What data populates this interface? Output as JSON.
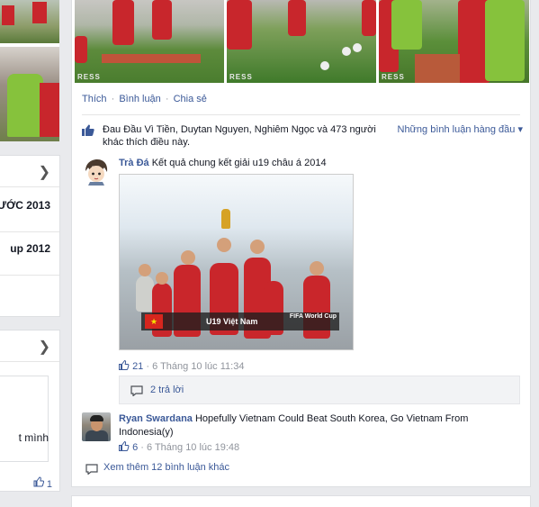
{
  "left": {
    "card1": {
      "items": [
        "ƯỚC 2013",
        "up 2012"
      ]
    },
    "card2": {
      "text": "t mình",
      "like_count": "1"
    }
  },
  "photos": {
    "watermark": "RESS"
  },
  "post_actions": {
    "like": "Thích",
    "comment": "Bình luận",
    "share": "Chia sẻ",
    "separator": "·"
  },
  "likes": {
    "text": "Đau Đầu Vì Tiền, Duytan Nguyen, Nghiêm Ngọc và 473 người khác thích điều này.",
    "sort_label": "Những bình luận hàng đầu ▾"
  },
  "comments": [
    {
      "author": "Trà Đá",
      "text": "Kết quả chung kết giải u19 châu á 2014",
      "image": {
        "banner_text": "U19 Việt Nam",
        "logo_text": "FIFA World Cup",
        "flag_star": "★"
      },
      "likes": "21",
      "time": "· 6 Tháng 10 lúc 11:34",
      "replies": "2 trả lời"
    },
    {
      "author": "Ryan Swardana",
      "text": "Hopefully Vietnam Could Beat South Korea, Go Vietnam From Indonesia(y)",
      "likes": "6",
      "time": "· 6 Tháng 10 lúc 19:48"
    }
  ],
  "more_comments": "Xem thêm 12 bình luận khác",
  "icons": {
    "like": "thumbs-up-icon",
    "reply": "comment-bubble-icon",
    "arrow": "chevron-right-icon"
  },
  "colors": {
    "link": "#3b5998",
    "bg": "#e9eaed",
    "muted": "#90949c"
  }
}
